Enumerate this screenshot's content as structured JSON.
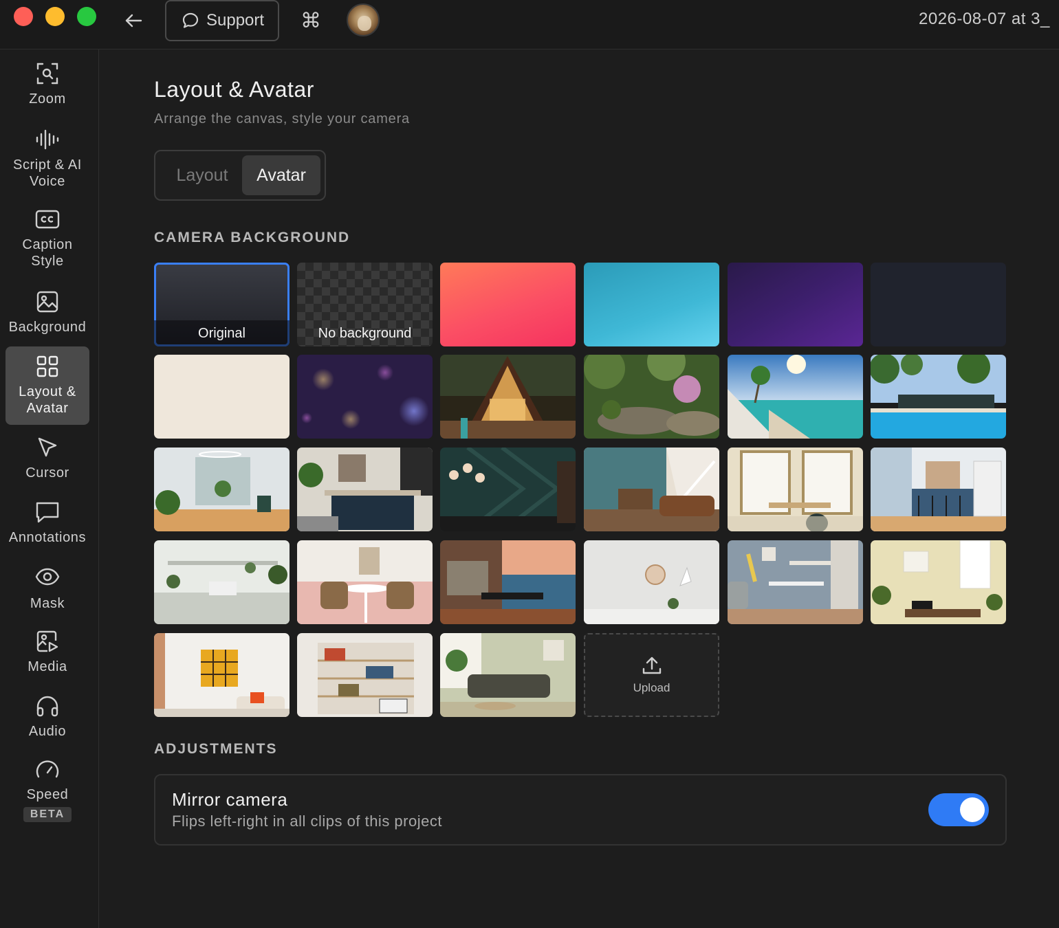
{
  "window": {
    "title": "2026-08-07 at 3_",
    "support_label": "Support"
  },
  "sidebar": {
    "items": [
      {
        "label": "Zoom",
        "icon": "zoom-icon"
      },
      {
        "label": "Script & AI Voice",
        "icon": "waveform-icon"
      },
      {
        "label": "Caption Style",
        "icon": "cc-icon"
      },
      {
        "label": "Background",
        "icon": "image-icon"
      },
      {
        "label": "Layout & Avatar",
        "icon": "layout-grid-icon",
        "active": true
      },
      {
        "label": "Cursor",
        "icon": "cursor-icon"
      },
      {
        "label": "Annotations",
        "icon": "speech-bubble-icon"
      },
      {
        "label": "Mask",
        "icon": "eye-icon"
      },
      {
        "label": "Media",
        "icon": "media-icon"
      },
      {
        "label": "Audio",
        "icon": "headphones-icon"
      },
      {
        "label": "Speed",
        "icon": "speedometer-icon",
        "badge": "BETA"
      }
    ]
  },
  "main": {
    "title": "Layout & Avatar",
    "subtitle": "Arrange the canvas, style your camera",
    "tabs": [
      {
        "label": "Layout",
        "active": false
      },
      {
        "label": "Avatar",
        "active": true
      }
    ],
    "camera_background": {
      "heading": "CAMERA BACKGROUND",
      "options": [
        {
          "label": "Original",
          "selected": true,
          "kind": "original"
        },
        {
          "label": "No background",
          "kind": "transparent"
        },
        {
          "kind": "gradient-pink"
        },
        {
          "kind": "gradient-cyan"
        },
        {
          "kind": "gradient-purple"
        },
        {
          "kind": "solid-navy"
        },
        {
          "kind": "solid-cream"
        },
        {
          "kind": "bokeh-purple"
        },
        {
          "kind": "photo-a-frame-cabin"
        },
        {
          "kind": "photo-garden"
        },
        {
          "kind": "photo-beach"
        },
        {
          "kind": "photo-pool"
        },
        {
          "kind": "photo-office"
        },
        {
          "kind": "photo-kitchen-dark"
        },
        {
          "kind": "photo-green-wall"
        },
        {
          "kind": "photo-living-stairs"
        },
        {
          "kind": "photo-window-room"
        },
        {
          "kind": "photo-blue-kitchen"
        },
        {
          "kind": "photo-white-studio"
        },
        {
          "kind": "photo-pink-dining"
        },
        {
          "kind": "photo-ocean-dining"
        },
        {
          "kind": "photo-white-wall-clock"
        },
        {
          "kind": "photo-grey-office"
        },
        {
          "kind": "photo-yellow-room"
        },
        {
          "kind": "photo-yellow-art"
        },
        {
          "kind": "photo-bookshelf"
        },
        {
          "kind": "photo-sage-sofa"
        }
      ],
      "upload_label": "Upload"
    },
    "adjustments": {
      "heading": "ADJUSTMENTS",
      "mirror": {
        "title": "Mirror camera",
        "description": "Flips left-right in all clips of this project",
        "enabled": true
      }
    }
  },
  "colors": {
    "accent": "#2f7bf5",
    "background": "#1d1d1d",
    "sidebar_active": "#4a4a4a"
  }
}
